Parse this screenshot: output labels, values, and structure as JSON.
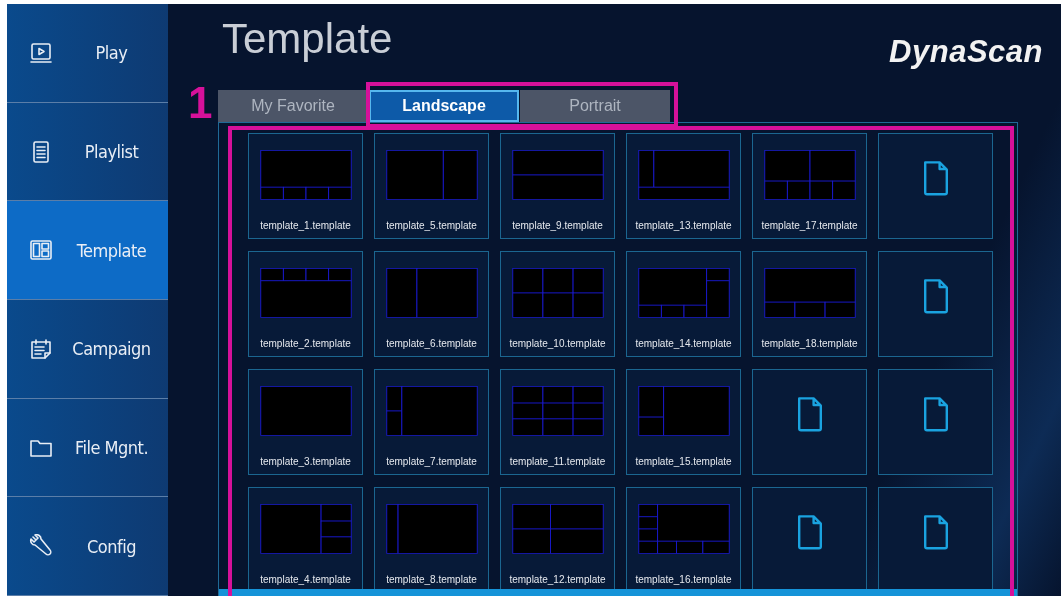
{
  "sidebar": {
    "items": [
      {
        "label": "Play",
        "selected": false
      },
      {
        "label": "Playlist",
        "selected": false
      },
      {
        "label": "Template",
        "selected": true
      },
      {
        "label": "Campaign",
        "selected": false
      },
      {
        "label": "File Mgnt.",
        "selected": false
      },
      {
        "label": "Config",
        "selected": false
      }
    ]
  },
  "header": {
    "title": "Template",
    "logo": "DynaScan"
  },
  "annotation": {
    "label": "1"
  },
  "tabs": [
    {
      "label": "My Favorite",
      "selected": false
    },
    {
      "label": "Landscape",
      "selected": true
    },
    {
      "label": "Portrait",
      "selected": false
    }
  ],
  "grid": {
    "cells": [
      {
        "kind": "template",
        "name": "template_1.template"
      },
      {
        "kind": "template",
        "name": "template_5.template"
      },
      {
        "kind": "template",
        "name": "template_9.template"
      },
      {
        "kind": "template",
        "name": "template_13.template"
      },
      {
        "kind": "template",
        "name": "template_17.template"
      },
      {
        "kind": "empty"
      },
      {
        "kind": "template",
        "name": "template_2.template"
      },
      {
        "kind": "template",
        "name": "template_6.template"
      },
      {
        "kind": "template",
        "name": "template_10.template"
      },
      {
        "kind": "template",
        "name": "template_14.template"
      },
      {
        "kind": "template",
        "name": "template_18.template"
      },
      {
        "kind": "empty"
      },
      {
        "kind": "template",
        "name": "template_3.template"
      },
      {
        "kind": "template",
        "name": "template_7.template"
      },
      {
        "kind": "template",
        "name": "template_11.template"
      },
      {
        "kind": "template",
        "name": "template_15.template"
      },
      {
        "kind": "empty"
      },
      {
        "kind": "empty"
      },
      {
        "kind": "template",
        "name": "template_4.template"
      },
      {
        "kind": "template",
        "name": "template_8.template"
      },
      {
        "kind": "template",
        "name": "template_12.template"
      },
      {
        "kind": "template",
        "name": "template_16.template"
      },
      {
        "kind": "empty"
      },
      {
        "kind": "empty"
      }
    ]
  }
}
